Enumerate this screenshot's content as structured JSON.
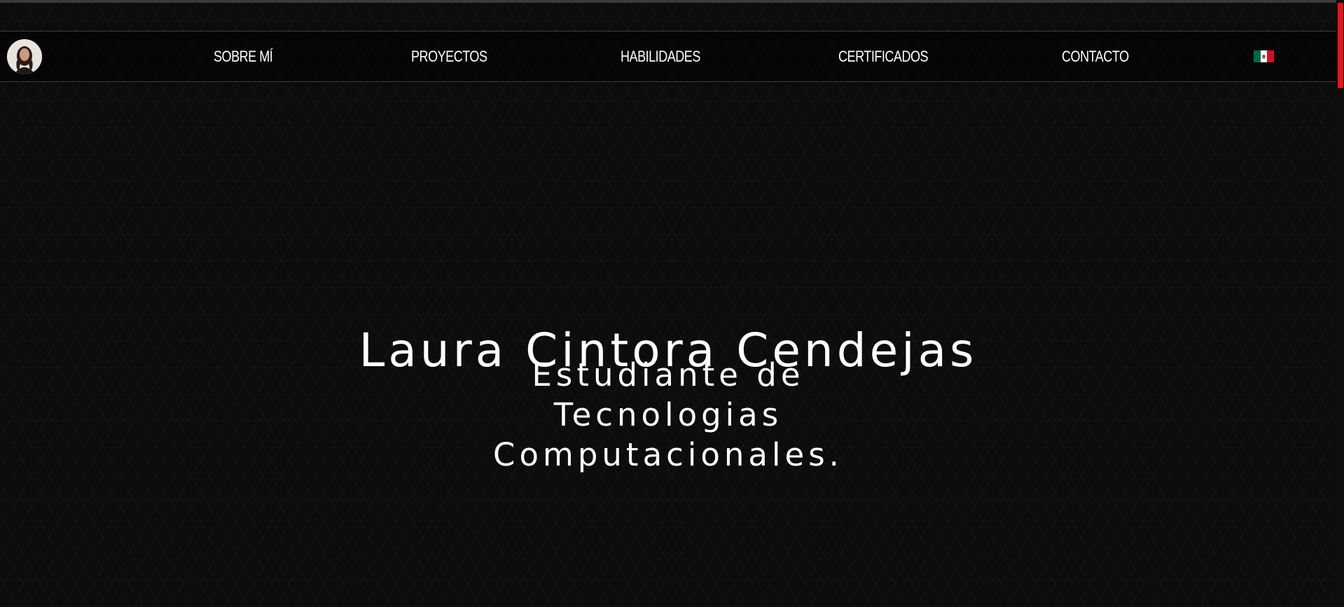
{
  "navbar": {
    "items": [
      {
        "label": "SOBRE MÍ"
      },
      {
        "label": "PROYECTOS"
      },
      {
        "label": "HABILIDADES"
      },
      {
        "label": "CERTIFICADOS"
      },
      {
        "label": "CONTACTO"
      }
    ],
    "language_icon": "mexico-flag-icon"
  },
  "hero": {
    "name": "Laura Cintora Cendejas",
    "subtitle_lines": [
      "Estudiante de",
      "Tecnologias",
      "Computacionales."
    ]
  },
  "colors": {
    "background": "#0c0c0c",
    "text": "#ffffff",
    "scroll_thumb": "#e3161b",
    "flag_green": "#006847",
    "flag_white": "#ffffff",
    "flag_red": "#ce1126"
  }
}
